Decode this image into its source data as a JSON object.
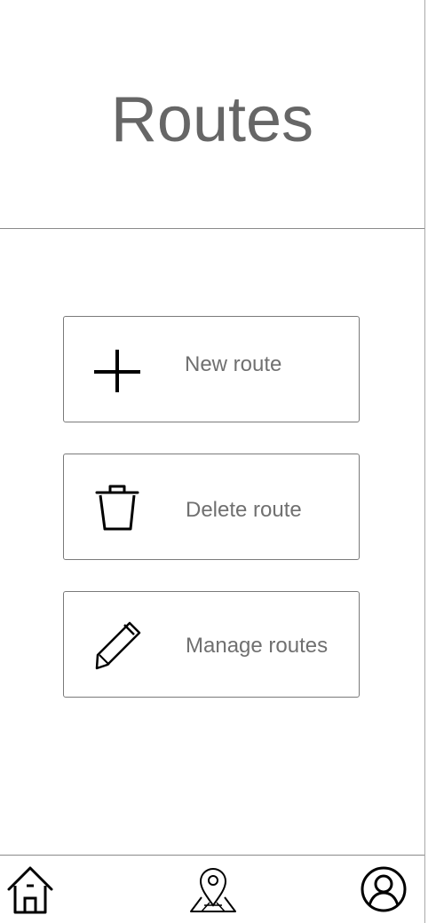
{
  "header": {
    "title": "Routes"
  },
  "actions": [
    {
      "label": "New route",
      "icon": "plus-icon"
    },
    {
      "label": "Delete route",
      "icon": "trash-icon"
    },
    {
      "label": "Manage routes",
      "icon": "pencil-icon"
    }
  ],
  "bottom_nav": [
    {
      "icon": "home-icon"
    },
    {
      "icon": "map-pin-icon"
    },
    {
      "icon": "user-profile-icon"
    }
  ],
  "colors": {
    "title_text": "#666666",
    "label_text": "#707070",
    "border": "#7a7a7a",
    "icon_stroke": "#000000",
    "background": "#ffffff"
  }
}
